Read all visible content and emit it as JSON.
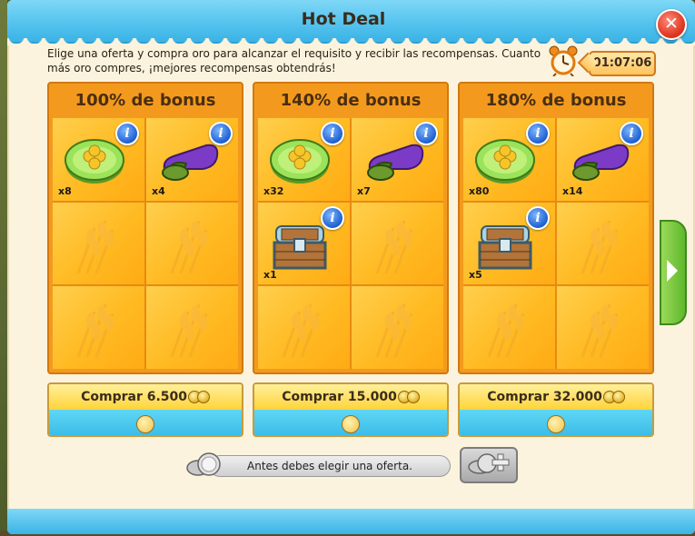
{
  "dialog": {
    "title": "Hot Deal",
    "close_label": "✕",
    "description": "Elige una oferta y compra oro para alcanzar el requisito y recibir las recompensas. Cuanto más oro compres, ¡mejores recompensas obtendrás!",
    "timer": "01:07:06",
    "status_message": "Antes debes elegir una oferta."
  },
  "offers": [
    {
      "bonus": "100% de bonus",
      "buy_label": "Comprar 6.500",
      "rewards": [
        {
          "icon": "clover-coin-icon",
          "qty": "x8"
        },
        {
          "icon": "seed-bag-icon",
          "qty": "x4"
        }
      ]
    },
    {
      "bonus": "140% de bonus",
      "buy_label": "Comprar 15.000",
      "rewards": [
        {
          "icon": "clover-coin-icon",
          "qty": "x32"
        },
        {
          "icon": "seed-bag-icon",
          "qty": "x7"
        },
        {
          "icon": "treasure-chest-icon",
          "qty": "x1"
        }
      ]
    },
    {
      "bonus": "180% de bonus",
      "buy_label": "Comprar 32.000",
      "rewards": [
        {
          "icon": "clover-coin-icon",
          "qty": "x80"
        },
        {
          "icon": "seed-bag-icon",
          "qty": "x14"
        },
        {
          "icon": "treasure-chest-icon",
          "qty": "x5"
        }
      ]
    }
  ],
  "colors": {
    "title_bar": "#5cc7f0",
    "card": "#f39a1e",
    "cell": "#ffba22",
    "close": "#e23b25"
  }
}
